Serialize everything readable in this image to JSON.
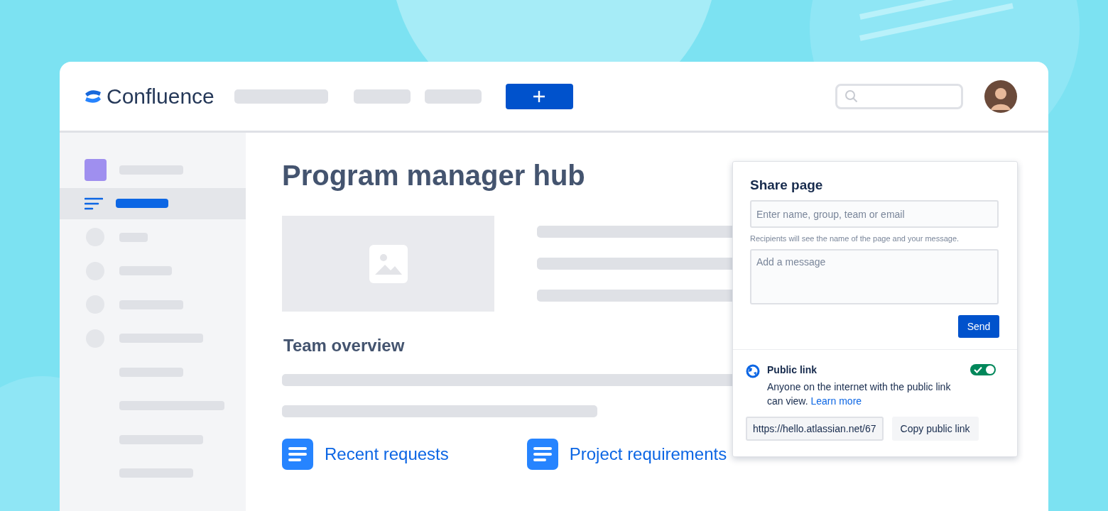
{
  "header": {
    "app_name": "Confluence"
  },
  "sidebar": {
    "items": [
      {
        "kind": "space",
        "selected": false
      },
      {
        "kind": "overview",
        "selected": true
      },
      {
        "kind": "circle",
        "selected": false
      },
      {
        "kind": "circle",
        "selected": false
      },
      {
        "kind": "circle",
        "selected": false
      },
      {
        "kind": "circle",
        "selected": false
      },
      {
        "kind": "child",
        "selected": false
      },
      {
        "kind": "child",
        "selected": false
      },
      {
        "kind": "child",
        "selected": false
      },
      {
        "kind": "child",
        "selected": false
      }
    ]
  },
  "page": {
    "title": "Program manager hub",
    "section_title": "Team overview",
    "links": [
      "Recent requests",
      "Project requirements"
    ]
  },
  "share_dialog": {
    "title": "Share page",
    "recipients": {
      "placeholder": "Enter name, group, team or email"
    },
    "hint": "Recipients will see the name of the page and your message.",
    "message": {
      "placeholder": "Add a message"
    },
    "send_button": "Send",
    "public_link": {
      "title": "Public link",
      "on": true,
      "description": "Anyone on the internet with the public link can view.",
      "learn_more": "Learn more",
      "url": "https://hello.atlassian.net/67",
      "copy_button": "Copy public link"
    }
  }
}
